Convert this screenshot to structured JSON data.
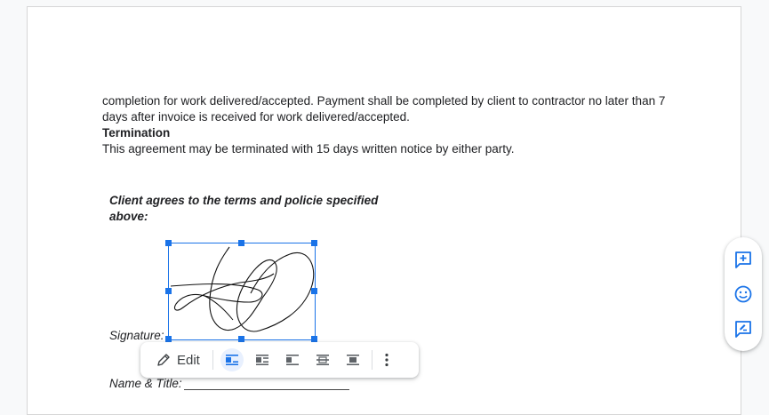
{
  "document": {
    "paragraph1": "completion for work delivered/accepted. Payment shall be completed by client to contractor no later than 7 days after invoice is received for work delivered/accepted.",
    "termination_heading": "Termination",
    "termination_text": "This agreement may be terminated with 15 days written notice by either party.",
    "agreement_text": "Client agrees to the terms and policie specified above:",
    "signature_label": "Signature:",
    "name_title_label": "Name & Title:"
  },
  "image_toolbar": {
    "edit_label": "Edit",
    "buttons": [
      "inline-icon",
      "wrap-text-icon",
      "break-text-icon",
      "behind-text-icon",
      "in-front-of-text-icon",
      "more-options-icon"
    ],
    "active": "inline-icon"
  },
  "side_actions": [
    "add-comment-icon",
    "emoji-reaction-icon",
    "suggest-edits-icon"
  ],
  "colors": {
    "accent": "#1a73e8",
    "active_bg": "#e8f0fe",
    "icon": "#3c4043"
  }
}
